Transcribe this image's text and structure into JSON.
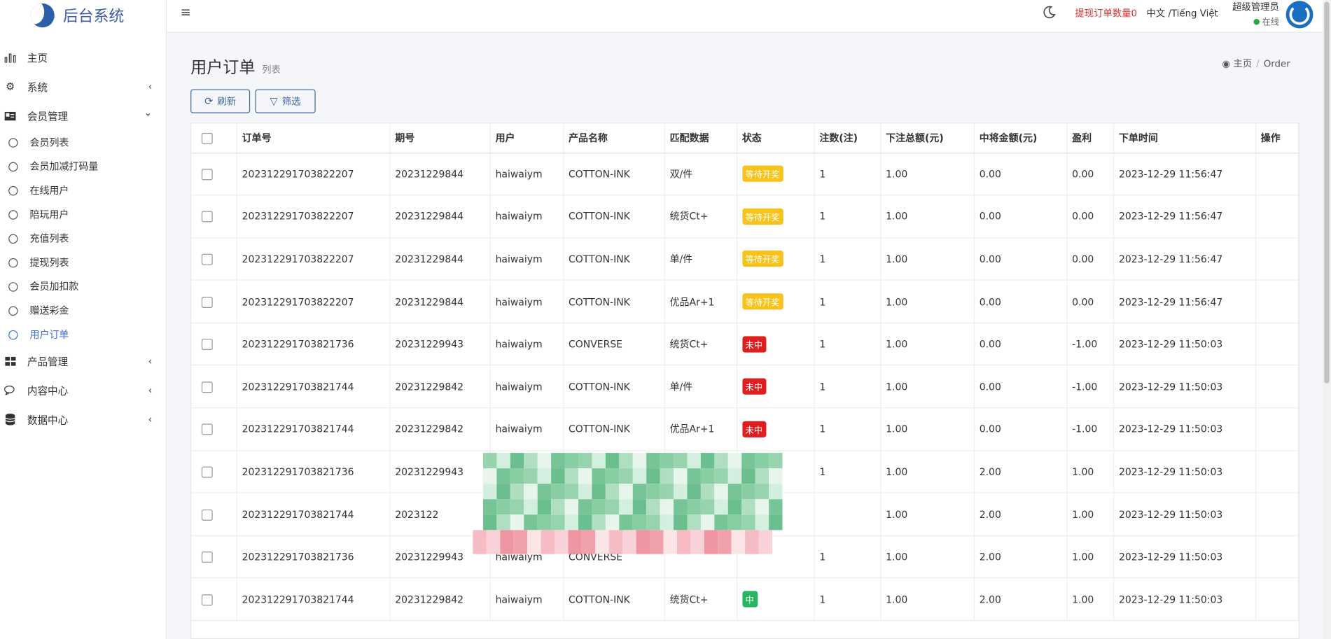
{
  "brand": {
    "name": "后台系统"
  },
  "topbar": {
    "withdraw_label": "提现订单数量",
    "withdraw_count": "0",
    "language": "中文 /Tiếng Việt",
    "admin_name": "超级管理员",
    "admin_status": "在线"
  },
  "sidebar": {
    "items": [
      {
        "label": "主页",
        "icon": "bar-chart-icon"
      },
      {
        "label": "系统",
        "icon": "gear-icon",
        "arrow": "‹"
      },
      {
        "label": "会员管理",
        "icon": "id-card-icon",
        "arrow": "⌄"
      },
      {
        "label": "产品管理",
        "icon": "grid-icon",
        "arrow": "‹"
      },
      {
        "label": "内容中心",
        "icon": "chat-icon",
        "arrow": "‹"
      },
      {
        "label": "数据中心",
        "icon": "database-icon",
        "arrow": "‹"
      }
    ],
    "member_sub": [
      {
        "label": "会员列表"
      },
      {
        "label": "会员加减打码量"
      },
      {
        "label": "在线用户"
      },
      {
        "label": "陪玩用户"
      },
      {
        "label": "充值列表"
      },
      {
        "label": "提现列表"
      },
      {
        "label": "会员加扣款"
      },
      {
        "label": "赠送彩金"
      },
      {
        "label": "用户订单",
        "active": true
      }
    ]
  },
  "page": {
    "title": "用户订单",
    "subtitle": "列表",
    "breadcrumb_home": "主页",
    "breadcrumb_current": "Order",
    "refresh_label": "刷新",
    "filter_label": "筛选"
  },
  "table": {
    "headers": [
      "订单号",
      "期号",
      "用户",
      "产品名称",
      "匹配数据",
      "状态",
      "注数(注)",
      "下注总额(元)",
      "中将金额(元)",
      "盈利",
      "下单时间",
      "操作"
    ],
    "rows": [
      {
        "order": "202312291703822207",
        "period": "20231229844",
        "user": "haiwaiym",
        "product": "COTTON-INK",
        "match": "双/件",
        "status": "等待开奖",
        "status_type": "wait",
        "bets": "1",
        "total": "1.00",
        "win": "0.00",
        "profit": "0.00",
        "time": "2023-12-29 11:56:47"
      },
      {
        "order": "202312291703822207",
        "period": "20231229844",
        "user": "haiwaiym",
        "product": "COTTON-INK",
        "match": "统货Ct+",
        "status": "等待开奖",
        "status_type": "wait",
        "bets": "1",
        "total": "1.00",
        "win": "0.00",
        "profit": "0.00",
        "time": "2023-12-29 11:56:47"
      },
      {
        "order": "202312291703822207",
        "period": "20231229844",
        "user": "haiwaiym",
        "product": "COTTON-INK",
        "match": "单/件",
        "status": "等待开奖",
        "status_type": "wait",
        "bets": "1",
        "total": "1.00",
        "win": "0.00",
        "profit": "0.00",
        "time": "2023-12-29 11:56:47"
      },
      {
        "order": "202312291703822207",
        "period": "20231229844",
        "user": "haiwaiym",
        "product": "COTTON-INK",
        "match": "优品Ar+1",
        "status": "等待开奖",
        "status_type": "wait",
        "bets": "1",
        "total": "1.00",
        "win": "0.00",
        "profit": "0.00",
        "time": "2023-12-29 11:56:47"
      },
      {
        "order": "202312291703821736",
        "period": "20231229943",
        "user": "haiwaiym",
        "product": "CONVERSE",
        "match": "统货Ct+",
        "status": "未中",
        "status_type": "lose",
        "bets": "1",
        "total": "1.00",
        "win": "0.00",
        "profit": "-1.00",
        "time": "2023-12-29 11:50:03"
      },
      {
        "order": "202312291703821744",
        "period": "20231229842",
        "user": "haiwaiym",
        "product": "COTTON-INK",
        "match": "单/件",
        "status": "未中",
        "status_type": "lose",
        "bets": "1",
        "total": "1.00",
        "win": "0.00",
        "profit": "-1.00",
        "time": "2023-12-29 11:50:03"
      },
      {
        "order": "202312291703821744",
        "period": "20231229842",
        "user": "haiwaiym",
        "product": "COTTON-INK",
        "match": "优品Ar+1",
        "status": "未中",
        "status_type": "lose",
        "bets": "1",
        "total": "1.00",
        "win": "0.00",
        "profit": "-1.00",
        "time": "2023-12-29 11:50:03"
      },
      {
        "order": "202312291703821736",
        "period": "20231229943",
        "user": "",
        "product": "",
        "match": "",
        "status": "",
        "status_type": "",
        "bets": "1",
        "total": "1.00",
        "win": "2.00",
        "profit": "1.00",
        "time": "2023-12-29 11:50:03"
      },
      {
        "order": "202312291703821744",
        "period": "2023122",
        "user": "",
        "product": "",
        "match": "",
        "status": "",
        "status_type": "",
        "bets": "",
        "total": "1.00",
        "win": "2.00",
        "profit": "1.00",
        "time": "2023-12-29 11:50:03"
      },
      {
        "order": "202312291703821736",
        "period": "20231229943",
        "user": "haiwaiym",
        "product": "CONVERSE",
        "match": "",
        "status": "",
        "status_type": "",
        "bets": "1",
        "total": "1.00",
        "win": "2.00",
        "profit": "1.00",
        "time": "2023-12-29 11:50:03"
      },
      {
        "order": "202312291703821744",
        "period": "20231229842",
        "user": "haiwaiym",
        "product": "COTTON-INK",
        "match": "统货Ct+",
        "status": "中",
        "status_type": "win",
        "bets": "1",
        "total": "1.00",
        "win": "2.00",
        "profit": "1.00",
        "time": "2023-12-29 11:50:03"
      }
    ]
  },
  "colors": {
    "accent": "#3c6fd1",
    "brand": "#3b5ca8",
    "wait": "#f7c31a",
    "lose": "#dd1f1f",
    "win": "#28b463",
    "alert": "#e02d2d"
  }
}
